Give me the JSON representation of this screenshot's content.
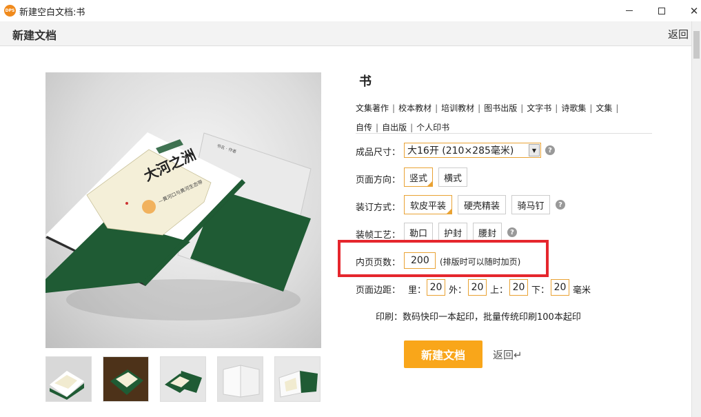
{
  "window": {
    "app_icon_text": "DPS",
    "title": "新建空白文档:书"
  },
  "header": {
    "title": "新建文档",
    "back_label": "返回"
  },
  "book": {
    "title": "书",
    "categories": [
      "文集著作",
      "校本教材",
      "培训教材",
      "图书出版",
      "文字书",
      "诗歌集",
      "文集",
      "自传",
      "自出版",
      "个人印书"
    ]
  },
  "size": {
    "label": "成品尺寸：",
    "value": "大16开 (210×285毫米)"
  },
  "orientation": {
    "label": "页面方向：",
    "options": [
      "竖式",
      "横式"
    ]
  },
  "binding": {
    "label": "装订方式：",
    "options": [
      "软皮平装",
      "硬壳精装",
      "骑马钉"
    ]
  },
  "crafts": {
    "label": "装帧工艺：",
    "options": [
      "勒口",
      "护封",
      "腰封"
    ]
  },
  "pages": {
    "label": "内页页数：",
    "value": "200",
    "hint": "(排版时可以随时加页)"
  },
  "margins": {
    "label": "页面边距：",
    "inner_label": "里：",
    "inner": "20",
    "outer_label": "外：",
    "outer": "20",
    "top_label": "上：",
    "top": "20",
    "bottom_label": "下：",
    "bottom": "20",
    "unit": "毫米"
  },
  "print_note": "印刷：数码快印一本起印，批量传统印刷100本起印",
  "actions": {
    "create_label": "新建文档",
    "back_label": "返回↵"
  },
  "book_cover": {
    "title": "大河之洲",
    "subtitle": "—黄河口与黄河生态带"
  },
  "colors": {
    "accent": "#f9a61a",
    "select_border": "#e9a233",
    "highlight": "#e5262d",
    "cover_green": "#1f5b34"
  }
}
